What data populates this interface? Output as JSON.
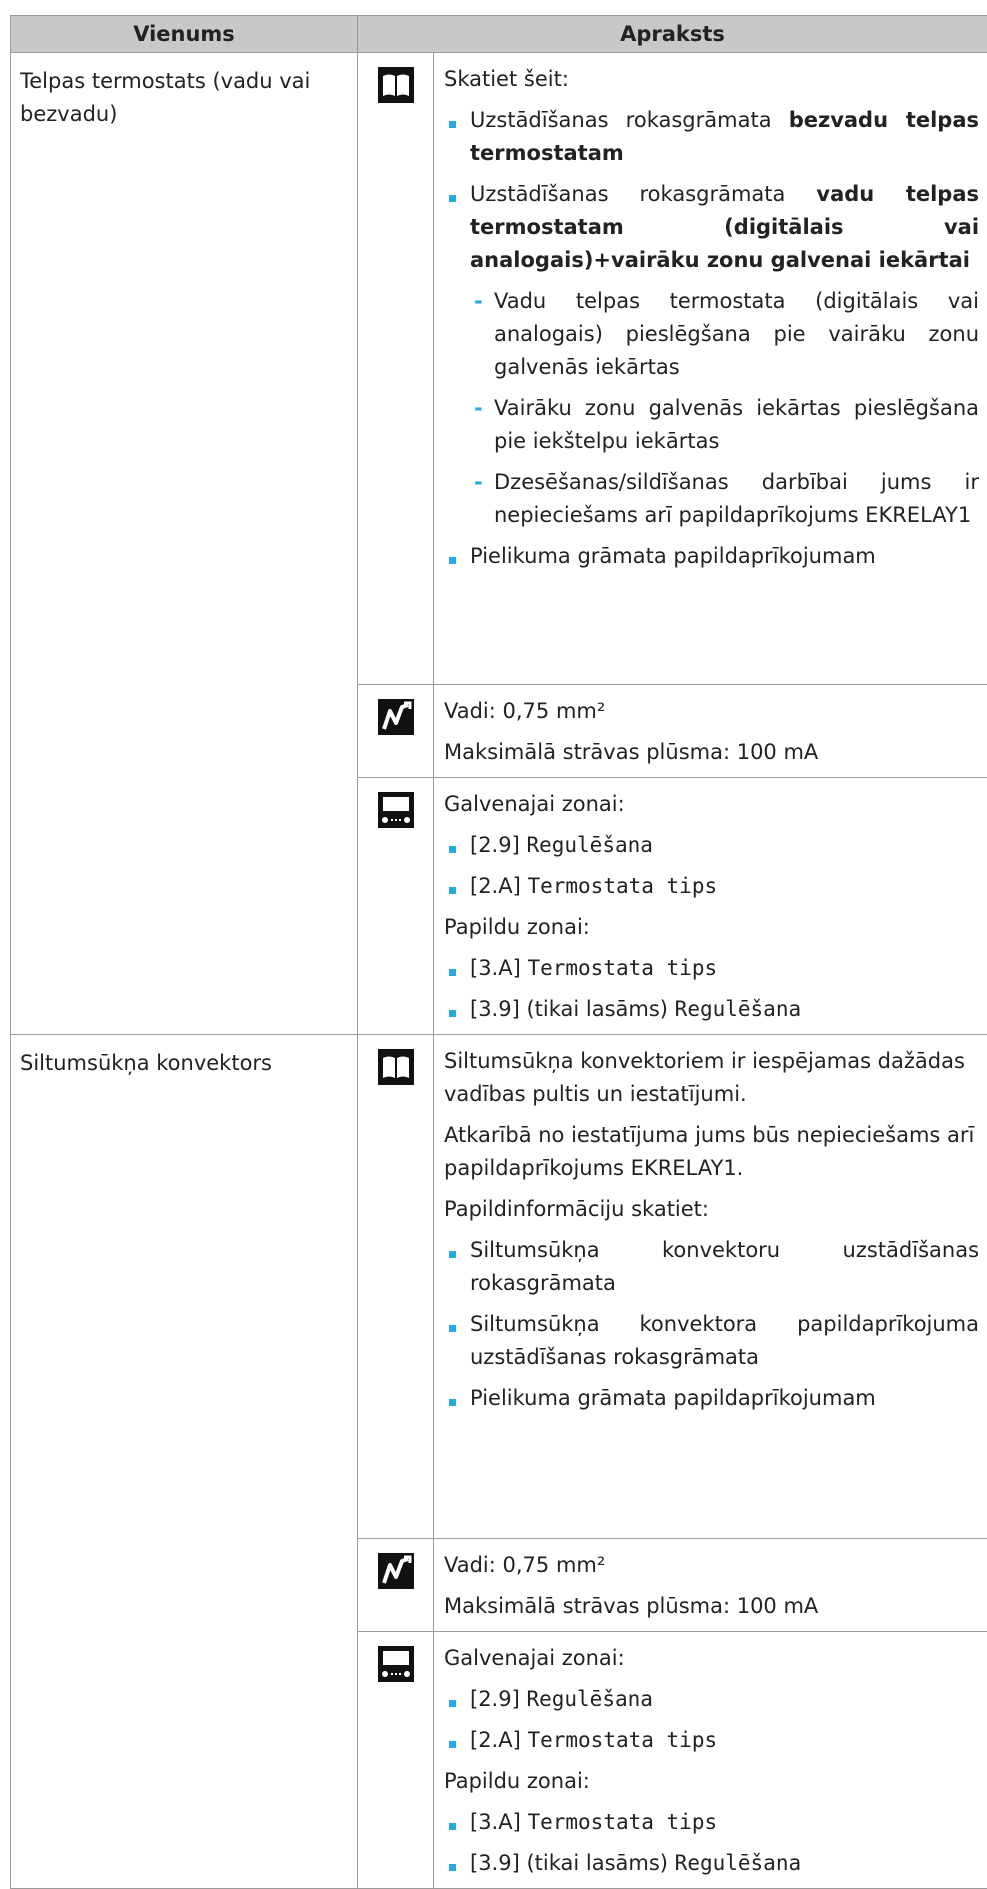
{
  "header": {
    "col1": "Vienums",
    "col2": "Apraksts"
  },
  "rows": [
    {
      "item": "Telpas termostats (vadu vai bezvadu)",
      "manual": {
        "intro": "Skatiet šeit:",
        "b1_pre": "Uzstādīšanas rokasgrāmata ",
        "b1_bold": "bezvadu telpas termostatam",
        "b2_pre": "Uzstādīšanas rokasgrāmata ",
        "b2_bold": "vadu telpas termostatam (digitālais vai analogais)+vairāku zonu galvenai iekārtai",
        "d1": "Vadu telpas termostata (digitālais vai analogais) pieslēgšana pie vairāku zonu galvenās iekārtas",
        "d2": "Vairāku zonu galvenās iekārtas pieslēgšana pie iekštelpu iekārtas",
        "d3": "Dzesēšanas/sildīšanas darbībai jums ir nepieciešams arī papildaprīkojums EKRELAY1",
        "b3": "Pielikuma grāmata papildaprīkojumam"
      },
      "wiring": {
        "l1": "Vadi: 0,75 mm²",
        "l2": "Maksimālā strāvas plūsma: 100 mA"
      },
      "settings": {
        "main_zone": "Galvenajai zonai:",
        "s1_code": "[2.9] ",
        "s1_name": "Regulēšana",
        "s2_code": "[2.A] ",
        "s2_name": "Termostata tips",
        "add_zone": "Papildu zonai:",
        "s3_code": "[3.A] ",
        "s3_name": "Termostata tips",
        "s4_code": "[3.9] (tikai lasāms) ",
        "s4_name": "Regulēšana"
      }
    },
    {
      "item": "Siltumsūkņa konvektors",
      "manual": {
        "p1": "Siltumsūkņa konvektoriem ir iespējamas dažādas vadības pultis un iestatījumi.",
        "p2": "Atkarībā no iestatījuma jums būs nepieciešams arī papildaprīkojums EKRELAY1.",
        "p3": "Papildinformāciju skatiet:",
        "b1": "Siltumsūkņa konvektoru uzstādīšanas rokasgrāmata",
        "b2": "Siltumsūkņa konvektora papildaprīkojuma uzstādīšanas rokasgrāmata",
        "b3": "Pielikuma grāmata papildaprīkojumam"
      },
      "wiring": {
        "l1": "Vadi: 0,75 mm²",
        "l2": "Maksimālā strāvas plūsma: 100 mA"
      },
      "settings": {
        "main_zone": "Galvenajai zonai:",
        "s1_code": "[2.9] ",
        "s1_name": "Regulēšana",
        "s2_code": "[2.A] ",
        "s2_name": "Termostata tips",
        "add_zone": "Papildu zonai:",
        "s3_code": "[3.A] ",
        "s3_name": "Termostata tips",
        "s4_code": "[3.9] (tikai lasāms) ",
        "s4_name": "Regulēšana"
      }
    }
  ],
  "icons": {
    "manual": "book-icon",
    "wiring": "wire-icon",
    "settings": "controller-icon"
  }
}
